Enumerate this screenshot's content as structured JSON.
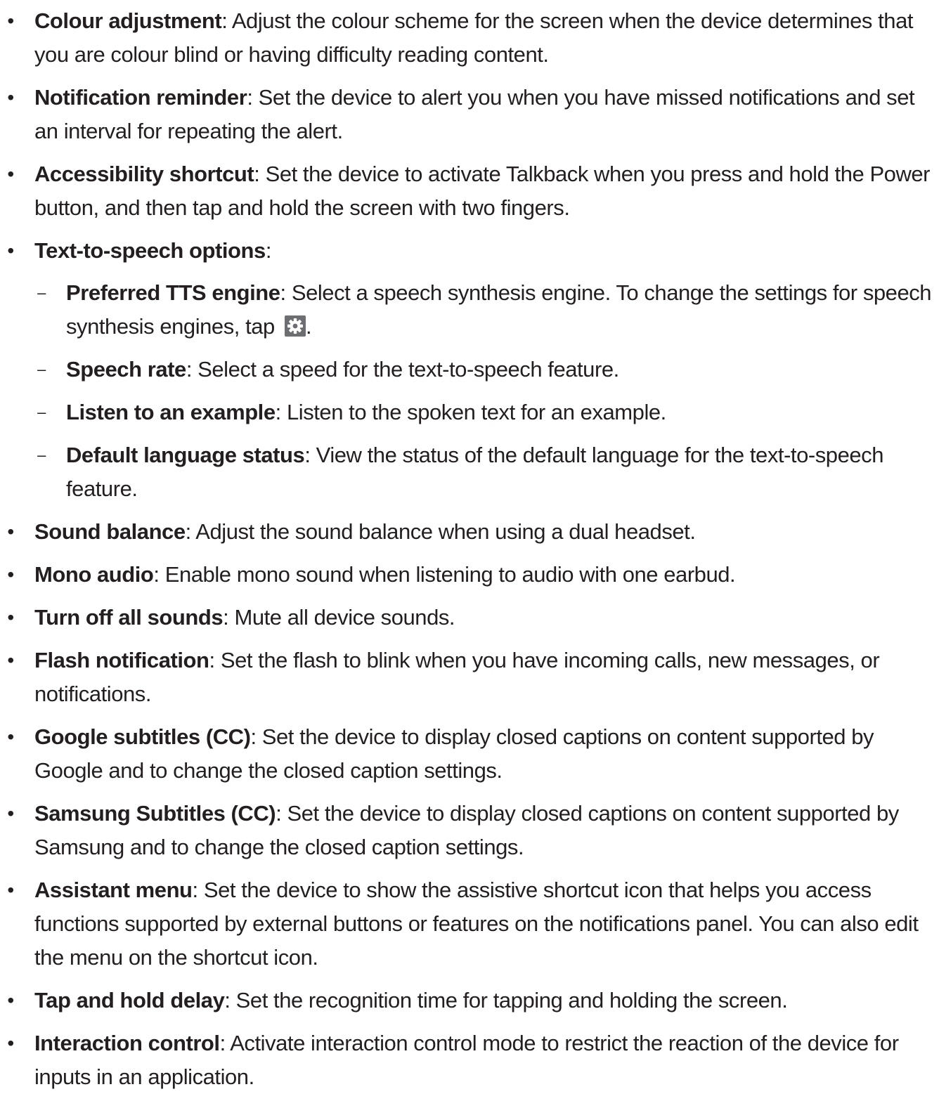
{
  "items": [
    {
      "term": "Colour adjustment",
      "desc": ": Adjust the colour scheme for the screen when the device determines that you are colour blind or having difficulty reading content."
    },
    {
      "term": "Notification reminder",
      "desc": ": Set the device to alert you when you have missed notifications and set an interval for repeating the alert."
    },
    {
      "term": "Accessibility shortcut",
      "desc": ": Set the device to activate Talkback when you press and hold the Power button, and then tap and hold the screen with two fingers."
    },
    {
      "term": "Text-to-speech options",
      "desc": ":"
    },
    {
      "term": "Sound balance",
      "desc": ": Adjust the sound balance when using a dual headset."
    },
    {
      "term": "Mono audio",
      "desc": ": Enable mono sound when listening to audio with one earbud."
    },
    {
      "term": "Turn off all sounds",
      "desc": ": Mute all device sounds."
    },
    {
      "term": "Flash notification",
      "desc": ": Set the flash to blink when you have incoming calls, new messages, or notifications."
    },
    {
      "term": "Google subtitles (CC)",
      "desc": ": Set the device to display closed captions on content supported by Google and to change the closed caption settings."
    },
    {
      "term": "Samsung Subtitles (CC)",
      "desc": ": Set the device to display closed captions on content supported by Samsung and to change the closed caption settings."
    },
    {
      "term": "Assistant menu",
      "desc": ": Set the device to show the assistive shortcut icon that helps you access functions supported by external buttons or features on the notifications panel. You can also edit the menu on the shortcut icon."
    },
    {
      "term": "Tap and hold delay",
      "desc": ": Set the recognition time for tapping and holding the screen."
    },
    {
      "term": "Interaction control",
      "desc": ": Activate interaction control mode to restrict the reaction of the device for inputs in an application."
    }
  ],
  "tts_subitems": [
    {
      "term": "Preferred TTS engine",
      "desc": ": Select a speech synthesis engine. To change the settings for speech synthesis engines, tap ",
      "icon": "settings-gear-icon",
      "after_icon": "."
    },
    {
      "term": "Speech rate",
      "desc": ": Select a speed for the text-to-speech feature."
    },
    {
      "term": "Listen to an example",
      "desc": ": Listen to the spoken text for an example."
    },
    {
      "term": "Default language status",
      "desc": ": View the status of the default language for the text-to-speech feature."
    }
  ],
  "colors": {
    "text": "#231f20",
    "icon_bg": "#6d6e71",
    "icon_fg": "#ffffff"
  }
}
